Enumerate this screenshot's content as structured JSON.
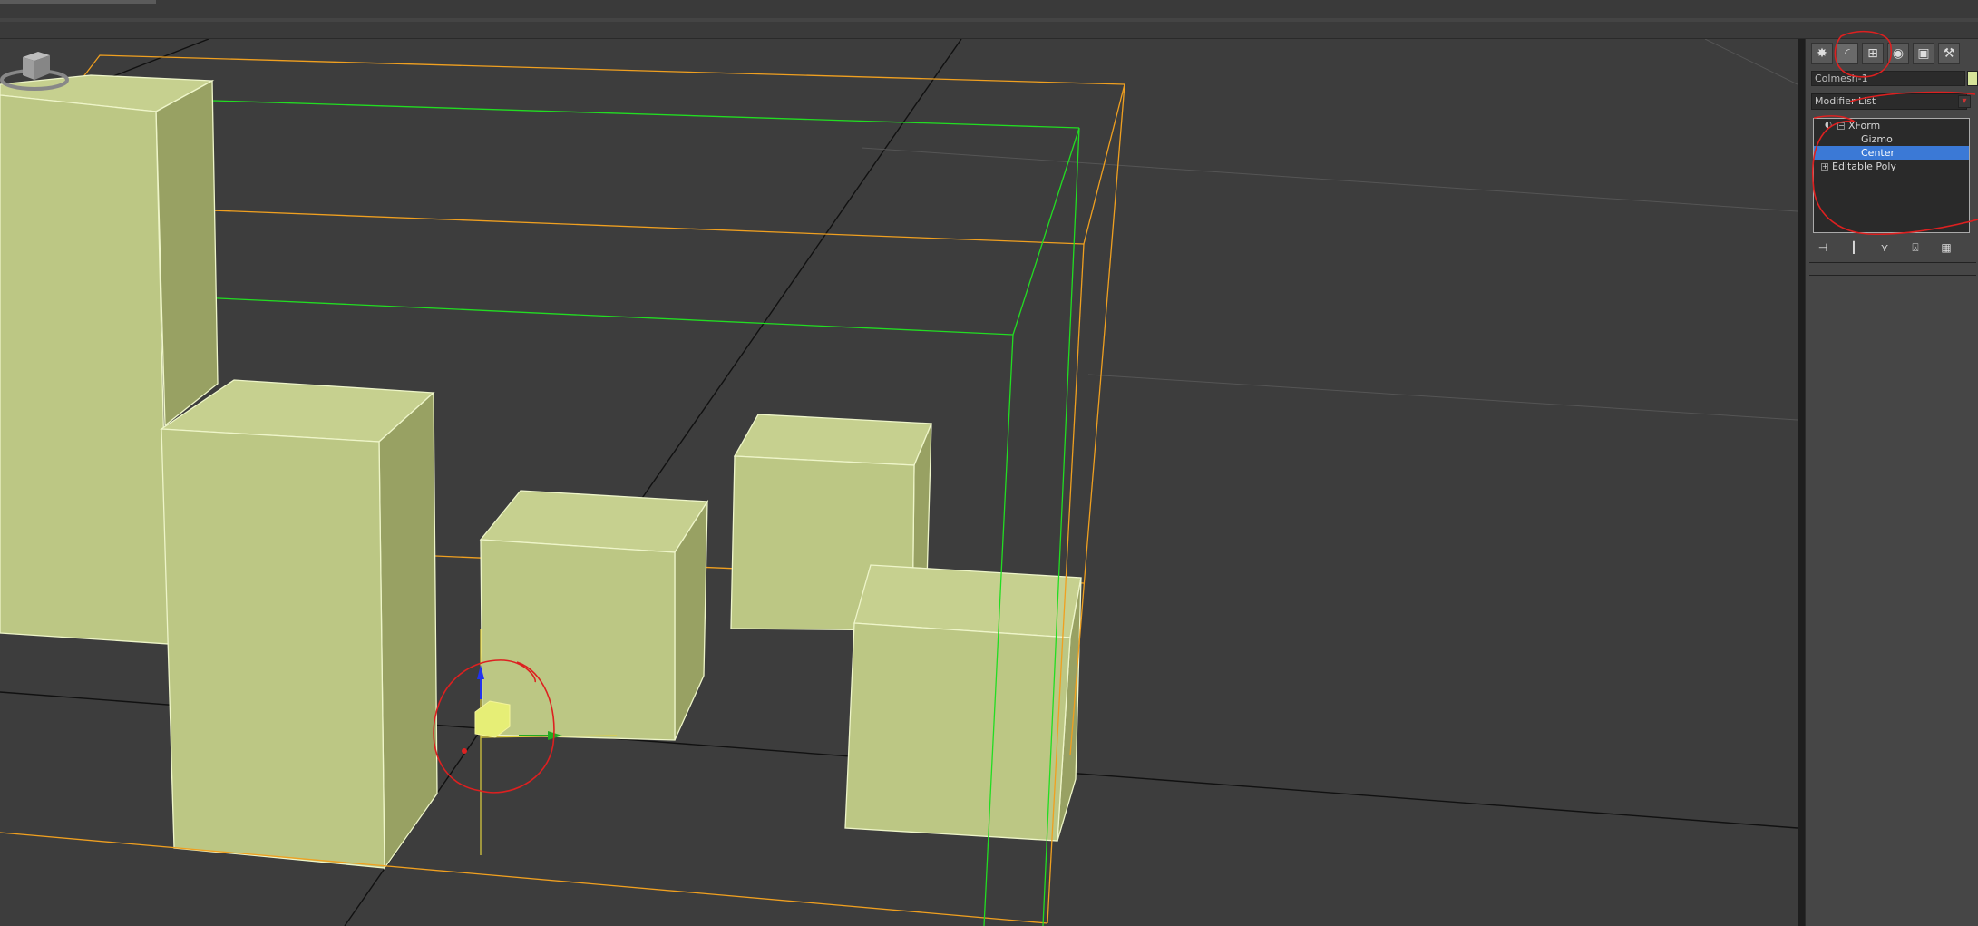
{
  "app": {
    "accent": "#f0a020"
  },
  "command_panel": {
    "tabs": [
      {
        "icon": "create-icon",
        "glyph": "✸"
      },
      {
        "icon": "modify-icon",
        "glyph": "◜"
      },
      {
        "icon": "hierarchy-icon",
        "glyph": "⊞"
      },
      {
        "icon": "motion-icon",
        "glyph": "◉"
      },
      {
        "icon": "display-icon",
        "glyph": "▣"
      },
      {
        "icon": "utilities-icon",
        "glyph": "⚒"
      }
    ],
    "object_name": "Colmesh-1",
    "object_color": "#d7e59a",
    "modifier_list_label": "Modifier List",
    "stack": [
      {
        "label": "XForm",
        "level": 0,
        "selected": false
      },
      {
        "label": "Gizmo",
        "level": 1,
        "selected": false
      },
      {
        "label": "Center",
        "level": 1,
        "selected": true
      },
      {
        "label": "Editable Poly",
        "level": 0,
        "selected": false
      }
    ]
  },
  "viewport": {
    "background": "#3d3d3d",
    "box_color": "#bcc784",
    "bbox_color": "#f0a020",
    "gizmo_color": "#22dd22"
  },
  "annotations": {
    "color": "#dd2020"
  }
}
